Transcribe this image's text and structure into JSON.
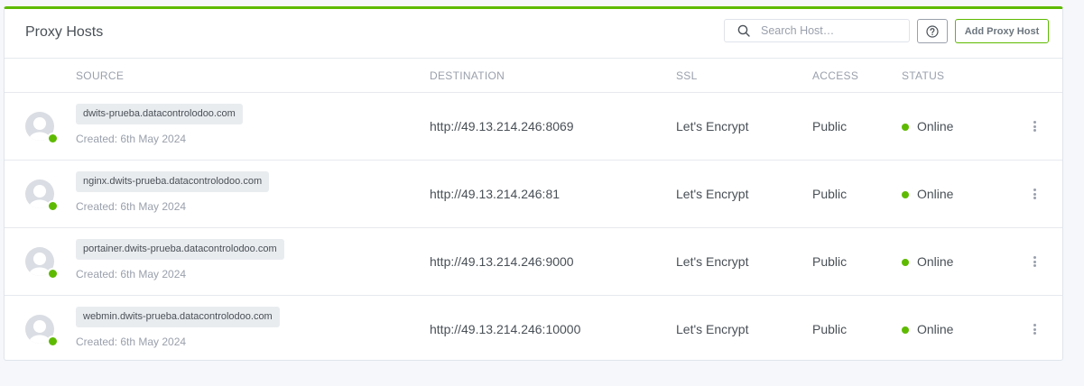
{
  "card": {
    "title": "Proxy Hosts",
    "search_placeholder": "Search Host…",
    "add_label": "Add Proxy Host",
    "accent_color": "#5eba00"
  },
  "columns": {
    "source": "SOURCE",
    "destination": "DESTINATION",
    "ssl": "SSL",
    "access": "ACCESS",
    "status": "STATUS"
  },
  "icons": {
    "search": "search-icon",
    "help": "help-circle-icon",
    "avatar": "user-avatar-icon",
    "menu": "more-vertical-icon"
  },
  "rows": [
    {
      "host": "dwits-prueba.datacontrolodoo.com",
      "created": "Created: 6th May 2024",
      "destination": "http://49.13.214.246:8069",
      "ssl": "Let's Encrypt",
      "access": "Public",
      "status": "Online"
    },
    {
      "host": "nginx.dwits-prueba.datacontrolodoo.com",
      "created": "Created: 6th May 2024",
      "destination": "http://49.13.214.246:81",
      "ssl": "Let's Encrypt",
      "access": "Public",
      "status": "Online"
    },
    {
      "host": "portainer.dwits-prueba.datacontrolodoo.com",
      "created": "Created: 6th May 2024",
      "destination": "http://49.13.214.246:9000",
      "ssl": "Let's Encrypt",
      "access": "Public",
      "status": "Online"
    },
    {
      "host": "webmin.dwits-prueba.datacontrolodoo.com",
      "created": "Created: 6th May 2024",
      "destination": "http://49.13.214.246:10000",
      "ssl": "Let's Encrypt",
      "access": "Public",
      "status": "Online"
    }
  ]
}
